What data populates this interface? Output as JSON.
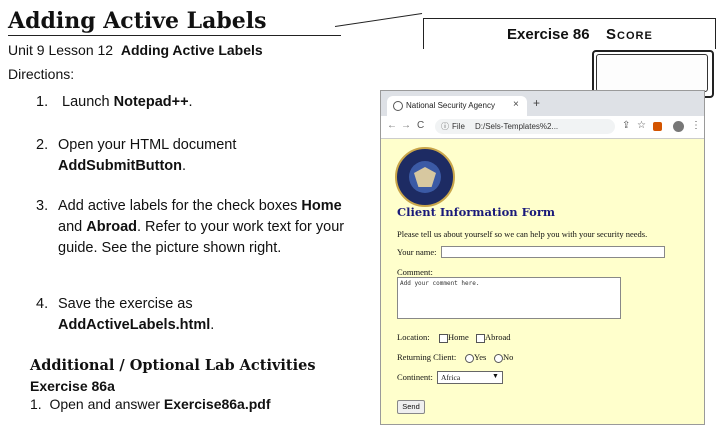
{
  "header": {
    "title": "Adding Active Labels",
    "exercise_label": "Exercise 86",
    "score_label": "Score"
  },
  "lesson": {
    "unit_prefix": "Unit 9 Lesson 12",
    "lesson_title": "Adding Active Labels",
    "directions_label": "Directions:"
  },
  "steps": [
    {
      "num": "1.",
      "pre": "Launch ",
      "bold": "Notepad++",
      "post": "."
    },
    {
      "num": "2.",
      "pre": "Open your HTML document ",
      "bold": "AddSubmitButton",
      "post": "."
    },
    {
      "num": "3.",
      "pre": "Add active labels for the check boxes ",
      "bold1": "Home",
      "mid": " and ",
      "bold2": "Abroad",
      "post": ". Refer to your work text for your guide. See the picture shown right."
    },
    {
      "num": "4.",
      "pre": "Save the exercise as ",
      "bold": "AddActiveLabels.html",
      "post": "."
    }
  ],
  "additional": {
    "heading": "Additional / Optional Lab Activities",
    "exercise": "Exercise 86a",
    "item_num": "1.",
    "item_pre": "Open and answer ",
    "item_bold": "Exercise86a.pdf"
  },
  "browser": {
    "tab_title": "National Security Agency",
    "tab_close": "×",
    "new_tab": "+",
    "nav_back": "←",
    "nav_forward": "→",
    "nav_reload": "C",
    "info_icon": "ⓘ",
    "file_label": "File",
    "url": "D:/Sels-Templates%2...",
    "share_icon": "⇪",
    "star_icon": "☆",
    "menu_icon": "⋮"
  },
  "form": {
    "heading": "Client Information Form",
    "intro": "Please tell us about yourself so we can help you with your security needs.",
    "name_label": "Your name:",
    "comment_label": "Comment:",
    "comment_placeholder": "Add your comment here.",
    "location_label": "Location:",
    "home_label": "Home",
    "abroad_label": "Abroad",
    "returning_label": "Returning Client:",
    "yes_label": "Yes",
    "no_label": "No",
    "continent_label": "Continent:",
    "continent_value": "Africa",
    "send_label": "Send"
  },
  "colors": {
    "page_bg": "#ffffcc",
    "heading": "#1a1a7a"
  }
}
